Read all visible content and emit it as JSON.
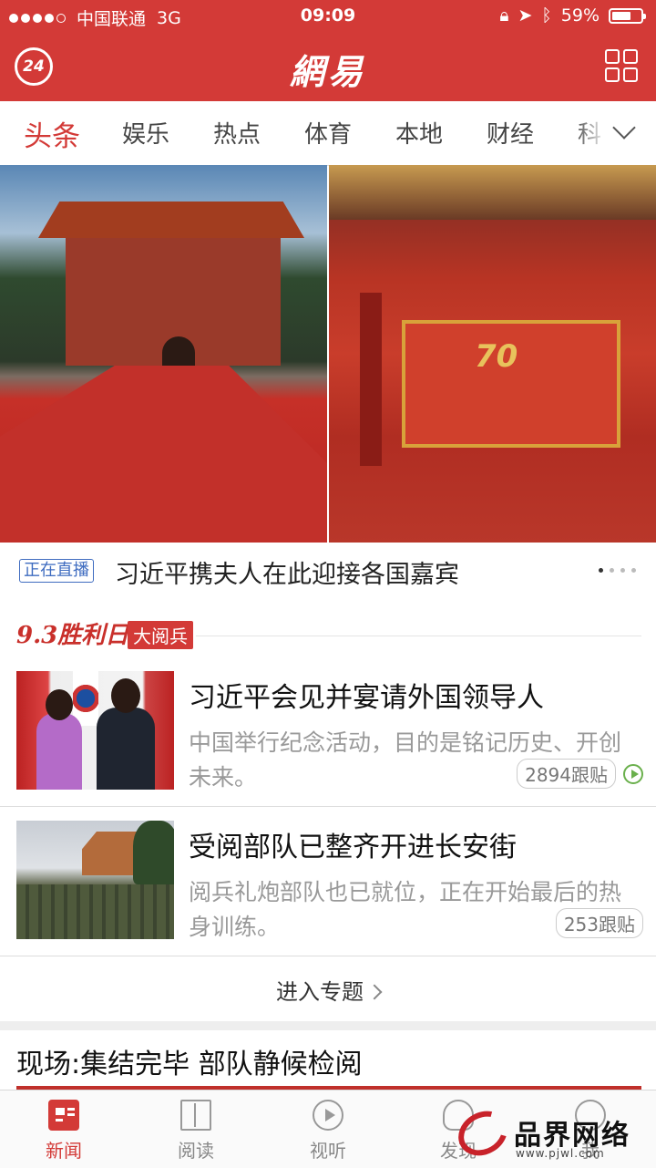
{
  "status_bar": {
    "carrier": "中国联通",
    "network": "3G",
    "time": "09:09",
    "battery": "59%",
    "battery_level": 0.59
  },
  "header": {
    "app_logo": "網易",
    "live24_label": "24",
    "accent_color": "#d33a37"
  },
  "channels": {
    "items": [
      "头条",
      "娱乐",
      "热点",
      "体育",
      "本地",
      "财经",
      "科"
    ],
    "active": "头条"
  },
  "hero": {
    "badge": "正在直播",
    "caption": "习近平携夫人在此迎接各国嘉宾",
    "page_count": 4,
    "current_page": 1,
    "photo_text": "70"
  },
  "special": {
    "logo": "9.3胜利日",
    "tag": "大阅兵"
  },
  "news": [
    {
      "title": "习近平会见并宴请外国领导人",
      "digest": "中国举行纪念活动，目的是铭记历史、开创未来。",
      "replies": "2894跟贴",
      "has_video": true
    },
    {
      "title": "受阅部队已整齐开进长安街",
      "digest": "阅兵礼炮部队也已就位，正在开始最后的热身训练。",
      "replies": "253跟贴",
      "has_video": false
    }
  ],
  "more_link": "进入专题",
  "section2_title": "现场:集结完毕 部队静候检阅",
  "tabbar": {
    "items": [
      {
        "label": "新闻",
        "icon": "news-icon"
      },
      {
        "label": "阅读",
        "icon": "book-icon"
      },
      {
        "label": "视听",
        "icon": "play-icon"
      },
      {
        "label": "发现",
        "icon": "lightbulb-icon"
      },
      {
        "label": "我",
        "icon": "user-icon"
      }
    ],
    "active": "新闻"
  },
  "watermark": {
    "brand": "品界网络",
    "url": "www.pjwl.com"
  }
}
